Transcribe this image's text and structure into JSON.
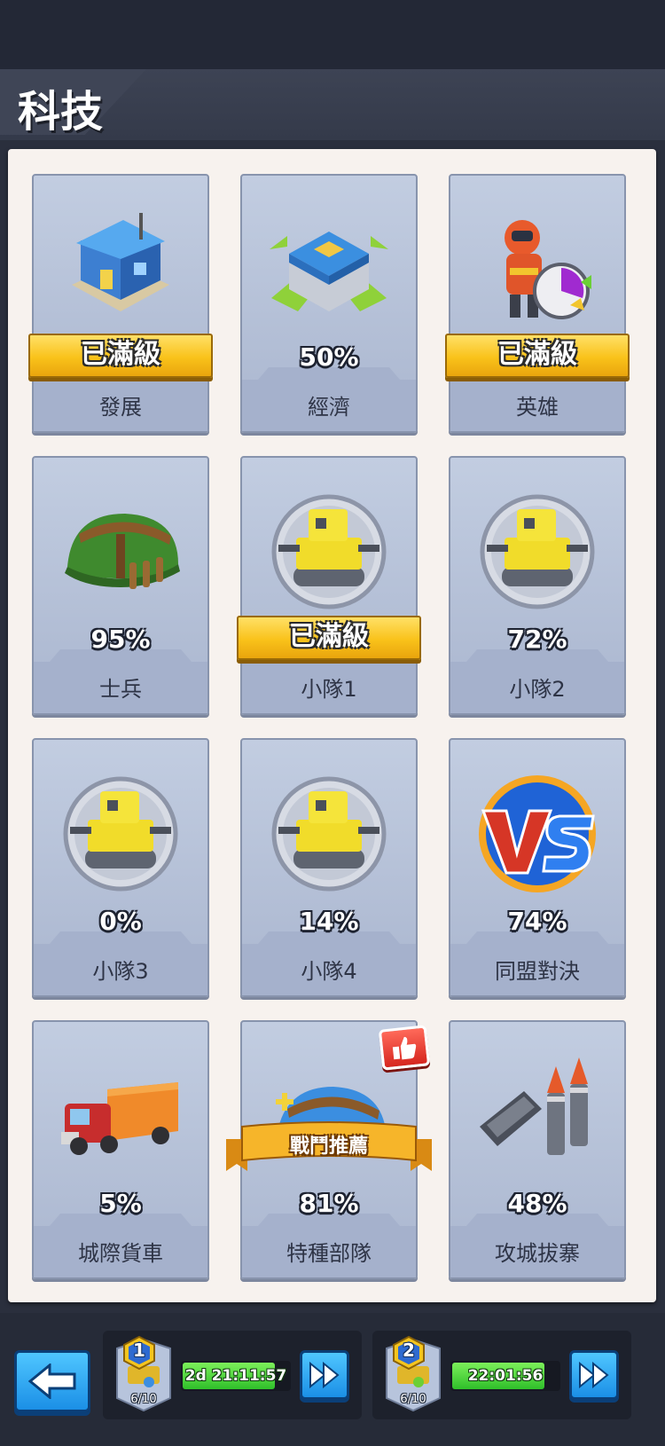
{
  "header": {
    "title": "科技"
  },
  "cards": [
    {
      "name": "發展",
      "progress": "已滿級",
      "maxed": true,
      "icon": "building-icon"
    },
    {
      "name": "經濟",
      "progress": "50%",
      "maxed": false,
      "icon": "economy-building-icon"
    },
    {
      "name": "英雄",
      "progress": "已滿級",
      "maxed": true,
      "icon": "hero-icon"
    },
    {
      "name": "士兵",
      "progress": "95%",
      "maxed": false,
      "icon": "helmet-icon"
    },
    {
      "name": "小隊1",
      "progress": "已滿級",
      "maxed": true,
      "icon": "tank-icon"
    },
    {
      "name": "小隊2",
      "progress": "72%",
      "maxed": false,
      "icon": "tank-icon"
    },
    {
      "name": "小隊3",
      "progress": "0%",
      "maxed": false,
      "icon": "tank-icon"
    },
    {
      "name": "小隊4",
      "progress": "14%",
      "maxed": false,
      "icon": "tank-icon"
    },
    {
      "name": "同盟對決",
      "progress": "74%",
      "maxed": false,
      "icon": "vs-icon"
    },
    {
      "name": "城際貨車",
      "progress": "5%",
      "maxed": false,
      "icon": "truck-icon"
    },
    {
      "name": "特種部隊",
      "progress": "81%",
      "maxed": false,
      "icon": "helmet-icon",
      "ribbon": "戰鬥推薦",
      "recommended": true
    },
    {
      "name": "攻城拔寨",
      "progress": "48%",
      "maxed": false,
      "icon": "rocket-icon"
    }
  ],
  "queues": [
    {
      "level": "1",
      "count": "6/10",
      "timer": "2d 21:11:57",
      "fill": 0.85
    },
    {
      "level": "2",
      "count": "6/10",
      "timer": "22:01:56",
      "fill": 0.85
    }
  ],
  "colors": {
    "panel": "#f7f2ee",
    "card": "#b5c1d9",
    "gold": "#f9c21a",
    "blue_button": "#1b8fe6",
    "timer_green": "#2fbf2a"
  }
}
